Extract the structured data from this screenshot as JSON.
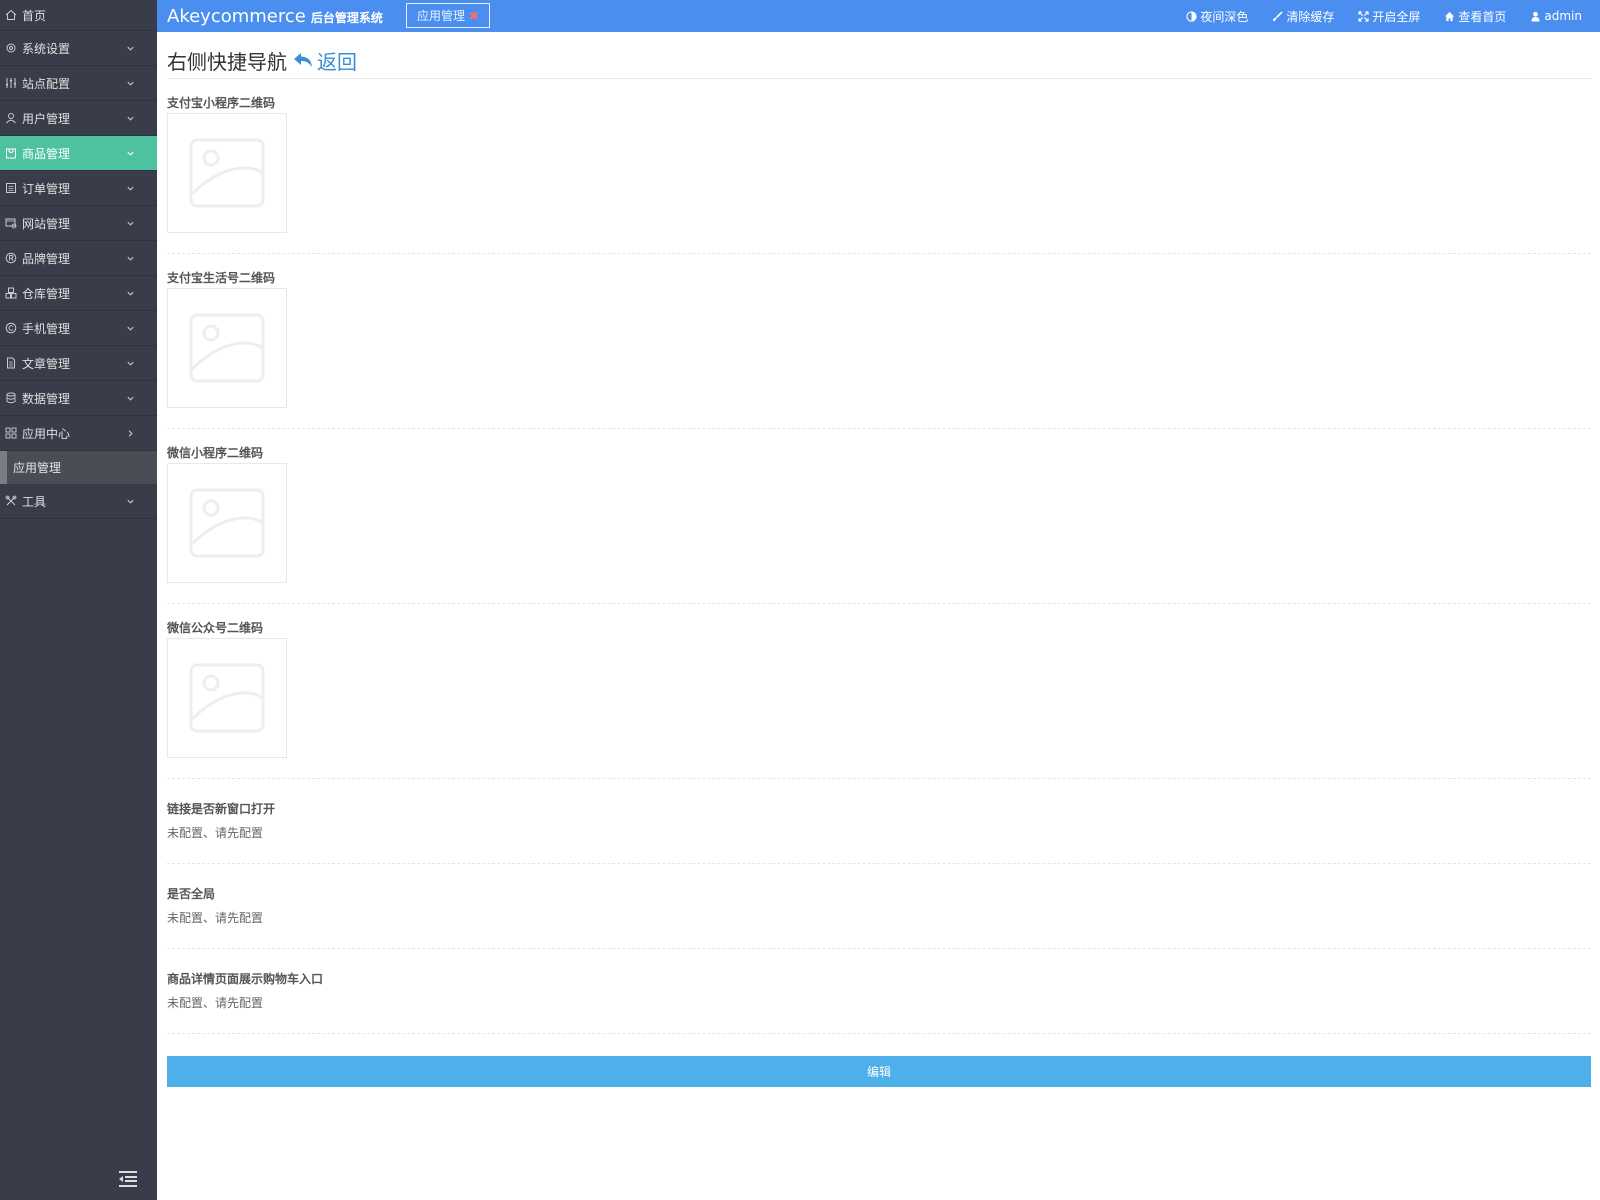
{
  "sidebar": {
    "home": "首页",
    "items": [
      {
        "label": "系统设置",
        "icon": "gear-icon",
        "arrow": "down"
      },
      {
        "label": "站点配置",
        "icon": "sliders-icon",
        "arrow": "down"
      },
      {
        "label": "用户管理",
        "icon": "user-icon",
        "arrow": "down"
      },
      {
        "label": "商品管理",
        "icon": "bag-icon",
        "arrow": "down",
        "active": true
      },
      {
        "label": "订单管理",
        "icon": "list-icon",
        "arrow": "down"
      },
      {
        "label": "网站管理",
        "icon": "browser-icon",
        "arrow": "down"
      },
      {
        "label": "品牌管理",
        "icon": "registered-icon",
        "arrow": "down"
      },
      {
        "label": "仓库管理",
        "icon": "boxes-icon",
        "arrow": "down"
      },
      {
        "label": "手机管理",
        "icon": "copyright-icon",
        "arrow": "down"
      },
      {
        "label": "文章管理",
        "icon": "file-icon",
        "arrow": "down"
      },
      {
        "label": "数据管理",
        "icon": "database-icon",
        "arrow": "down"
      },
      {
        "label": "应用中心",
        "icon": "grid-icon",
        "arrow": "right"
      }
    ],
    "sub_item": "应用管理",
    "tools": "工具"
  },
  "topbar": {
    "brand": "Akeycommerce",
    "brand_sub": "后台管理系统",
    "tab": "应用管理",
    "actions": [
      "夜间深色",
      "清除缓存",
      "开启全屏",
      "查看首页",
      "admin"
    ]
  },
  "main": {
    "title": "右侧快捷导航",
    "back": "返回",
    "qr_fields": [
      "支付宝小程序二维码",
      "支付宝生活号二维码",
      "微信小程序二维码",
      "微信公众号二维码"
    ],
    "text_fields": [
      {
        "label": "链接是否新窗口打开",
        "value": "未配置、请先配置"
      },
      {
        "label": "是否全局",
        "value": "未配置、请先配置"
      },
      {
        "label": "商品详情页面展示购物车入口",
        "value": "未配置、请先配置"
      }
    ],
    "edit_button": "编辑"
  },
  "colors": {
    "sidebar_bg": "#393d49",
    "active_green": "#4ec1a1",
    "topbar_blue": "#4a8ef0",
    "button_blue": "#4eb0ea",
    "link_blue": "#3a8ed8"
  }
}
